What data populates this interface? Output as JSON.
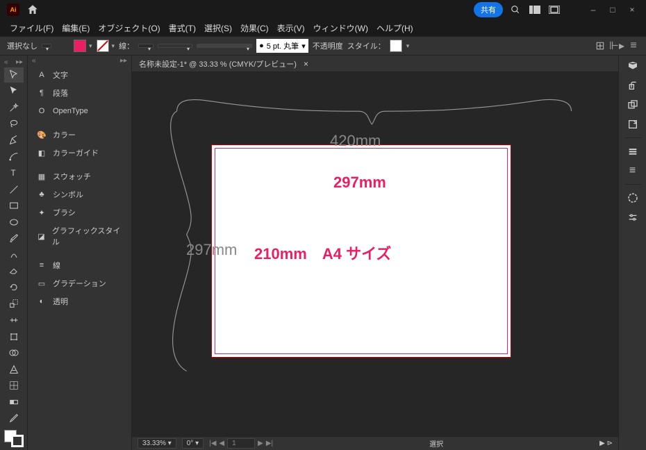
{
  "titlebar": {
    "share_label": "共有"
  },
  "menu": {
    "file": "ファイル(F)",
    "edit": "編集(E)",
    "object": "オブジェクト(O)",
    "type": "書式(T)",
    "select": "選択(S)",
    "effect": "効果(C)",
    "view": "表示(V)",
    "window": "ウィンドウ(W)",
    "help": "ヘルプ(H)"
  },
  "control": {
    "no_selection": "選択なし",
    "stroke_label": "線：",
    "stroke_weight": "5 pt. 丸筆",
    "opacity_label": "不透明度",
    "style_label": "スタイル："
  },
  "panels": {
    "items": [
      {
        "label": "文字",
        "glyph": "A"
      },
      {
        "label": "段落",
        "glyph": "¶"
      },
      {
        "label": "OpenType",
        "glyph": "O"
      },
      {
        "label": "カラー",
        "glyph": "🎨"
      },
      {
        "label": "カラーガイド",
        "glyph": "◧"
      },
      {
        "label": "スウォッチ",
        "glyph": "▦"
      },
      {
        "label": "シンボル",
        "glyph": "♣"
      },
      {
        "label": "ブラシ",
        "glyph": "✦"
      },
      {
        "label": "グラフィックスタイル",
        "glyph": "◪"
      },
      {
        "label": "線",
        "glyph": "≡"
      },
      {
        "label": "グラデーション",
        "glyph": "▭"
      },
      {
        "label": "透明",
        "glyph": "◐"
      }
    ]
  },
  "document": {
    "tab_title": "名称未設定-1* @ 33.33 % (CMYK/プレビュー)"
  },
  "canvas_labels": {
    "width_outer": "420mm",
    "height_outer": "297mm",
    "width_inner": "297mm",
    "height_inner_a4": "210mm　A4 サイズ"
  },
  "status": {
    "zoom": "33.33%",
    "rotate": "0°",
    "page": "1",
    "tool": "選択"
  }
}
